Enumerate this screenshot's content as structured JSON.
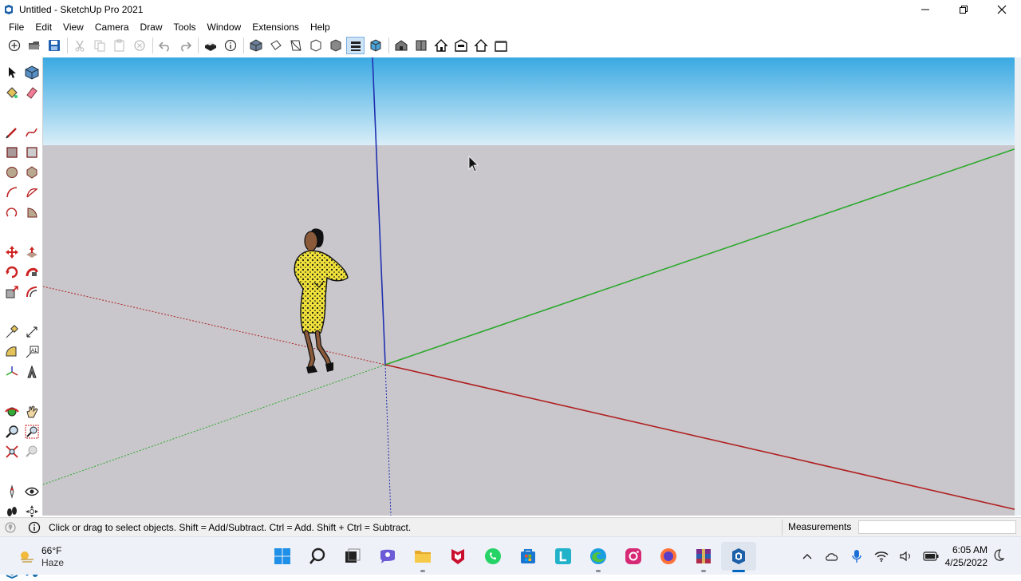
{
  "window": {
    "title": "Untitled - SketchUp Pro 2021",
    "app_icon": "sketchup-logo-icon",
    "controls": [
      "minimize-icon",
      "restore-icon",
      "close-icon"
    ]
  },
  "menubar": {
    "items": [
      {
        "label": "File"
      },
      {
        "label": "Edit"
      },
      {
        "label": "View"
      },
      {
        "label": "Camera"
      },
      {
        "label": "Draw"
      },
      {
        "label": "Tools"
      },
      {
        "label": "Window"
      },
      {
        "label": "Extensions"
      },
      {
        "label": "Help"
      }
    ]
  },
  "toolbar": {
    "icons": [
      "new-file-icon",
      "open-folder-icon",
      "save-icon",
      "cut-icon",
      "copy-icon",
      "paste-icon",
      "erase-selection-icon",
      "undo-icon",
      "redo-icon",
      "print-icon",
      "model-info-icon",
      "iso-view-icon",
      "top-view-icon",
      "front-view-icon",
      "right-view-icon",
      "back-view-icon",
      "left-view-icon",
      "xray-style-icon",
      "wireframe-style-icon",
      "hidden-line-icon",
      "shaded-icon",
      "shaded-textures-icon",
      "monochrome-icon"
    ]
  },
  "left_toolbar": {
    "tools": [
      "select-tool-icon",
      "make-component-icon",
      "paint-bucket-icon",
      "eraser-icon",
      "line-tool-icon",
      "freehand-tool-icon",
      "rectangle-tool-icon",
      "rotated-rectangle-icon",
      "circle-tool-icon",
      "polygon-tool-icon",
      "arc-tool-icon",
      "two-point-arc-icon",
      "three-point-arc-icon",
      "pie-tool-icon",
      "move-tool-icon",
      "push-pull-icon",
      "rotate-tool-icon",
      "follow-me-icon",
      "scale-tool-icon",
      "offset-tool-icon",
      "tape-measure-icon",
      "dimension-tool-icon",
      "protractor-icon",
      "text-tool-icon",
      "axes-tool-icon",
      "3d-text-icon",
      "orbit-tool-icon",
      "pan-tool-icon",
      "zoom-tool-icon",
      "zoom-window-icon",
      "zoom-extents-icon",
      "previous-view-icon",
      "position-camera-icon",
      "look-around-icon",
      "walk-tool-icon",
      "section-plane-icon",
      "display-section-icon",
      "display-section-cuts-icon",
      "section-fill-icon",
      "3d-warehouse-icon"
    ]
  },
  "scene": {
    "sky_color": "#4ab3e6",
    "ground_color": "#c9c7cc",
    "axis_red": "#b02020",
    "axis_green": "#2aa82a",
    "axis_blue": "#2030b0",
    "figure": "scale-figure-woman-yellow-dress"
  },
  "statusbar": {
    "hint": "Click or drag to select objects. Shift = Add/Subtract. Ctrl = Add. Shift + Ctrl = Subtract.",
    "measurements_label": "Measurements",
    "measurements_value": ""
  },
  "taskbar": {
    "weather": {
      "temp": "66°F",
      "condition": "Haze"
    },
    "apps": [
      "start-icon",
      "search-icon",
      "task-view-icon",
      "chat-icon",
      "file-explorer-icon",
      "mcafee-icon",
      "whatsapp-icon",
      "microsoft-store-icon",
      "l-app-icon",
      "edge-icon",
      "instagram-icon",
      "firefox-icon",
      "winrar-icon",
      "sketchup-taskbar-icon"
    ],
    "tray": [
      "chevron-up-icon",
      "onedrive-icon",
      "microphone-icon",
      "wifi-icon",
      "speaker-icon",
      "battery-icon"
    ],
    "time": "6:05 AM",
    "date": "4/25/2022"
  }
}
